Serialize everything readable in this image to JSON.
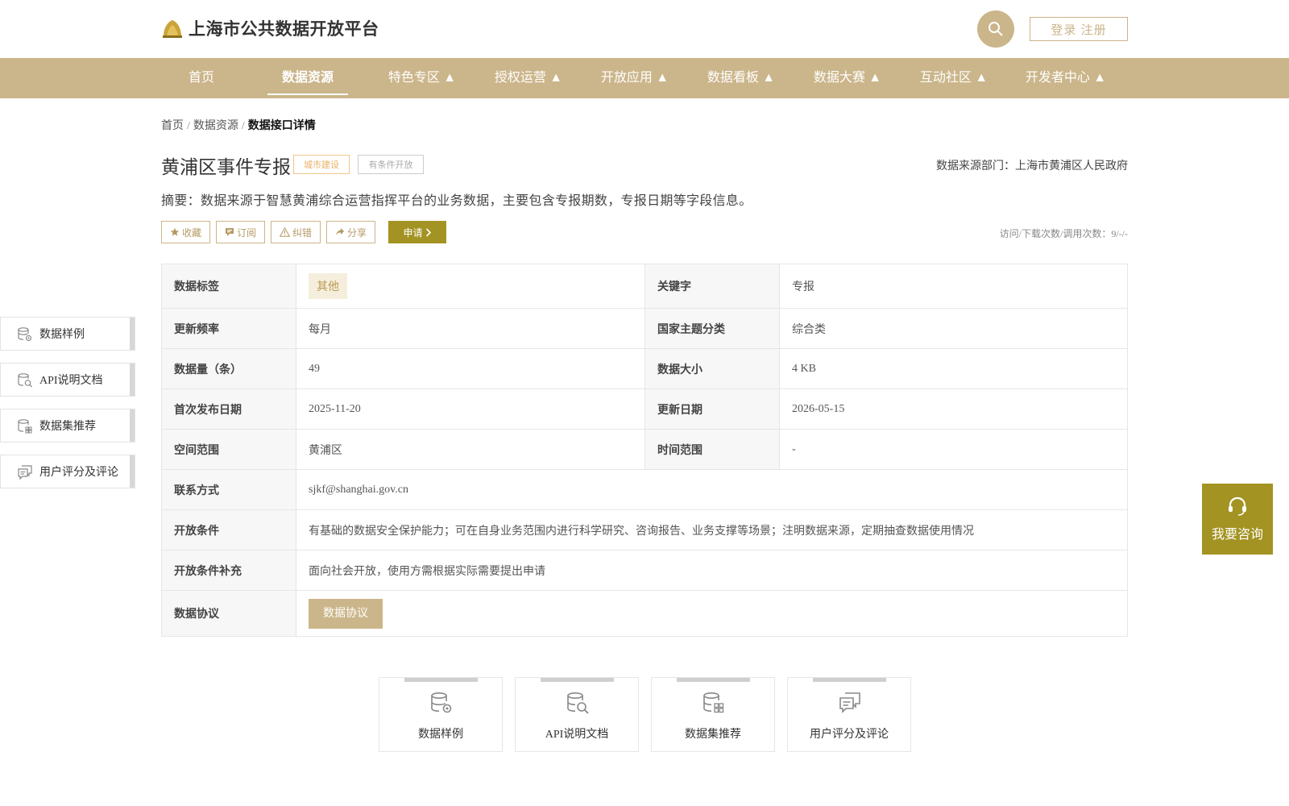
{
  "header": {
    "site_title": "上海市公共数据开放平台",
    "login_label": "登录 注册"
  },
  "nav": {
    "items": [
      {
        "label": "首页"
      },
      {
        "label": "数据资源"
      },
      {
        "label": "特色专区 ▲"
      },
      {
        "label": "授权运营 ▲"
      },
      {
        "label": "开放应用 ▲"
      },
      {
        "label": "数据看板 ▲"
      },
      {
        "label": "数据大赛 ▲"
      },
      {
        "label": "互动社区 ▲"
      },
      {
        "label": "开发者中心 ▲"
      }
    ],
    "active": "数据资源"
  },
  "breadcrumb": {
    "home": "首页",
    "section": "数据资源",
    "current": "数据接口详情",
    "sep": "/"
  },
  "dataset": {
    "title": "黄浦区事件专报",
    "tag_category": "城市建设",
    "tag_open": "有条件开放",
    "source": "数据来源部门：上海市黄浦区人民政府",
    "summary": "摘要：数据来源于智慧黄浦综合运营指挥平台的业务数据，主要包含专报期数，专报日期等字段信息。",
    "counts": "访问/下载次数/调用次数：9/-/-"
  },
  "actions": {
    "favorite": "收藏",
    "subscribe": "订阅",
    "correct": "纠错",
    "share": "分享",
    "apply": "申请"
  },
  "table": {
    "data_tag_label": "数据标签",
    "data_tag_value": "其他",
    "keyword_label": "关键字",
    "keyword_value": "专报",
    "freq_label": "更新频率",
    "freq_value": "每月",
    "theme_label": "国家主题分类",
    "theme_value": "综合类",
    "count_label": "数据量（条）",
    "count_value": "49",
    "size_label": "数据大小",
    "size_value": "4 KB",
    "first_pub_label": "首次发布日期",
    "first_pub_value": "2025-11-20",
    "update_label": "更新日期",
    "update_value": "2026-05-15",
    "space_label": "空间范围",
    "space_value": "黄浦区",
    "time_label": "时间范围",
    "time_value": "-",
    "contact_label": "联系方式",
    "contact_value": "sjkf@shanghai.gov.cn",
    "cond_label": "开放条件",
    "cond_value": "有基础的数据安全保护能力；可在自身业务范围内进行科学研究、咨询报告、业务支撑等场景；注明数据来源，定期抽查数据使用情况",
    "cond_extra_label": "开放条件补充",
    "cond_extra_value": "面向社会开放，使用方需根据实际需要提出申请",
    "agreement_label": "数据协议",
    "agreement_button": "数据协议"
  },
  "side_menu": [
    {
      "label": "数据样例",
      "icon": "database-gear-icon"
    },
    {
      "label": "API说明文档",
      "icon": "document-search-icon"
    },
    {
      "label": "数据集推荐",
      "icon": "database-grid-icon"
    },
    {
      "label": "用户评分及评论",
      "icon": "chat-bubbles-icon"
    }
  ],
  "consult": {
    "label": "我要咨询"
  },
  "cards": [
    {
      "label": "数据样例"
    },
    {
      "label": "API说明文档"
    },
    {
      "label": "数据集推荐"
    },
    {
      "label": "用户评分及评论"
    }
  ],
  "colors": {
    "brand": "#cbb58a",
    "apply": "#a39322",
    "chip_bg": "#f6eedd"
  }
}
